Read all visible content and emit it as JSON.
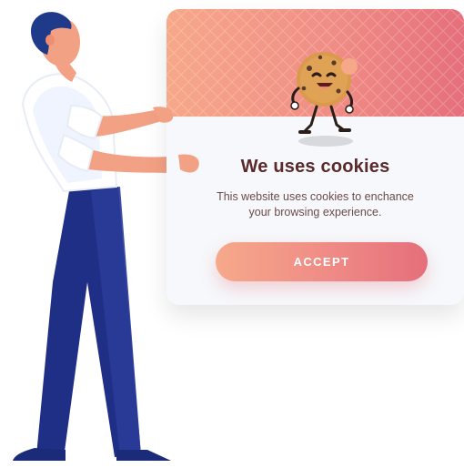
{
  "consent": {
    "title": "We uses cookies",
    "description_line1": "This website uses cookies to enchance",
    "description_line2": "your browsing experience.",
    "accept_label": "ACCEPT"
  },
  "colors": {
    "accent_start": "#f7a889",
    "accent_end": "#e56f7b",
    "title": "#5b2a2a",
    "card_bg": "#f6f8fb",
    "pants": "#24358f",
    "shirt": "#ffffff",
    "hair": "#203a8a",
    "skin": "#f3a184"
  },
  "icons": {
    "mascot": "cookie-mascot-icon",
    "person": "person-illustration"
  }
}
